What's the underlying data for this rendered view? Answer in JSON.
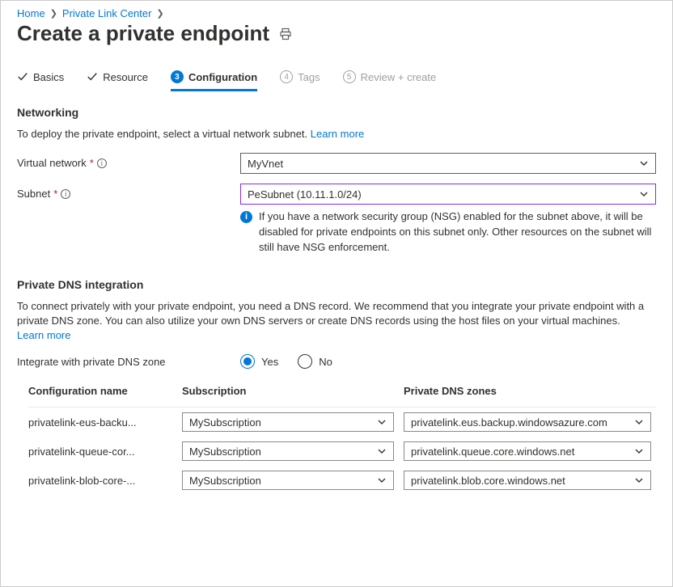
{
  "breadcrumb": {
    "home": "Home",
    "center": "Private Link Center"
  },
  "title": "Create a private endpoint",
  "tabs": {
    "basics": "Basics",
    "resource": "Resource",
    "configuration_num": "3",
    "configuration": "Configuration",
    "tags_num": "4",
    "tags": "Tags",
    "review_num": "5",
    "review": "Review + create"
  },
  "networking": {
    "heading": "Networking",
    "desc_prefix": "To deploy the private endpoint, select a virtual network subnet.  ",
    "learn_more": "Learn more",
    "vnet_label": "Virtual network",
    "vnet_value": "MyVnet",
    "subnet_label": "Subnet",
    "subnet_value": "PeSubnet (10.11.1.0/24)",
    "callout": "If you have a network security group (NSG) enabled for the subnet above, it will be disabled for private endpoints on this subnet only. Other resources on the subnet will still have NSG enforcement."
  },
  "dns": {
    "heading": "Private DNS integration",
    "desc": "To connect privately with your private endpoint, you need a DNS record. We recommend that you integrate your private endpoint with a private DNS zone. You can also utilize your own DNS servers or create DNS records using the host files on your virtual machines.   ",
    "learn_more": "Learn more",
    "integrate_label": "Integrate with private DNS zone",
    "yes": "Yes",
    "no": "No",
    "col_config": "Configuration name",
    "col_sub": "Subscription",
    "col_zone": "Private DNS zones",
    "rows": [
      {
        "name": "privatelink-eus-backu...",
        "sub": "MySubscription",
        "zone": "privatelink.eus.backup.windowsazure.com"
      },
      {
        "name": "privatelink-queue-cor...",
        "sub": "MySubscription",
        "zone": "privatelink.queue.core.windows.net"
      },
      {
        "name": "privatelink-blob-core-...",
        "sub": "MySubscription",
        "zone": "privatelink.blob.core.windows.net"
      }
    ]
  }
}
